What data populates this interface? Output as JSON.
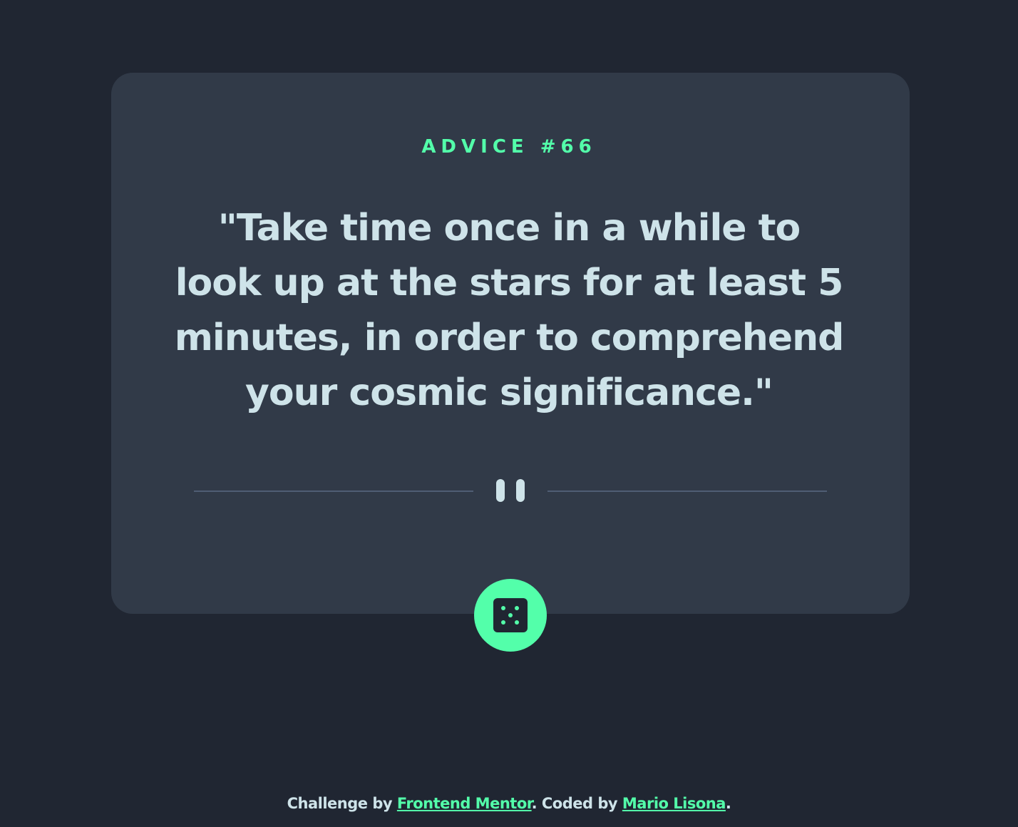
{
  "card": {
    "advice_label": "ADVICE #66",
    "quote": "\"Take time once in a while to look up at the stars for at least 5 minutes, in order to comprehend your cosmic significance.\"",
    "divider_icon": "pause-icon",
    "dice_button_icon": "dice-icon"
  },
  "attribution": {
    "prefix": "Challenge by ",
    "challenge_link": "Frontend Mentor",
    "middle": ". Coded by ",
    "author_link": "Mario Lisona",
    "suffix": "."
  },
  "colors": {
    "background": "#202632",
    "card": "#313a48",
    "accent": "#53ffaa",
    "text": "#cee3e9",
    "divider": "#4f5d74"
  }
}
